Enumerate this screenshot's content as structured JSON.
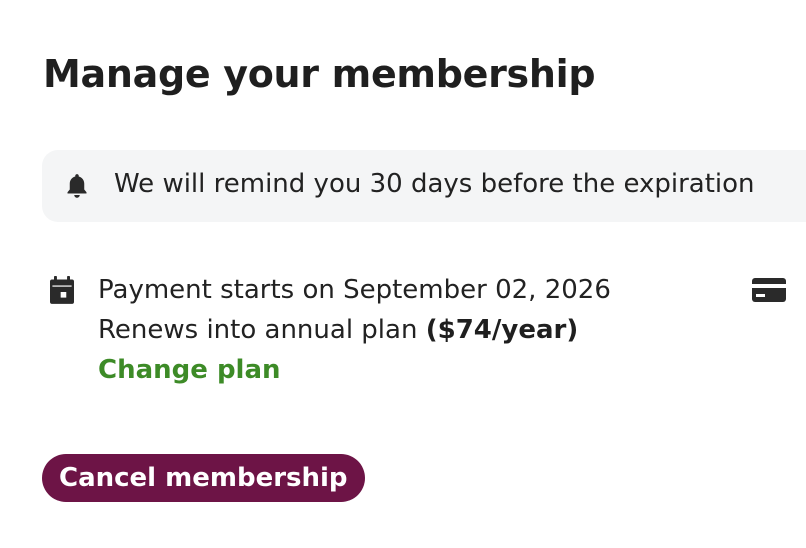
{
  "page": {
    "title": "Manage your membership"
  },
  "reminder": {
    "icon": "bell-icon",
    "text": "We will remind you 30 days before the expiration"
  },
  "payment": {
    "icon": "calendar-icon",
    "start_text": "Payment starts on September 02, 2026",
    "renew_prefix": "Renews into annual plan ",
    "renew_price": "($74/year)",
    "change_plan_label": "Change plan",
    "side_icon": "credit-card-icon"
  },
  "actions": {
    "cancel_label": "Cancel membership"
  },
  "colors": {
    "accent_green": "#3d8b27",
    "cancel_button_bg": "#6d1446",
    "reminder_bg": "#f4f5f6",
    "text": "#222222"
  }
}
